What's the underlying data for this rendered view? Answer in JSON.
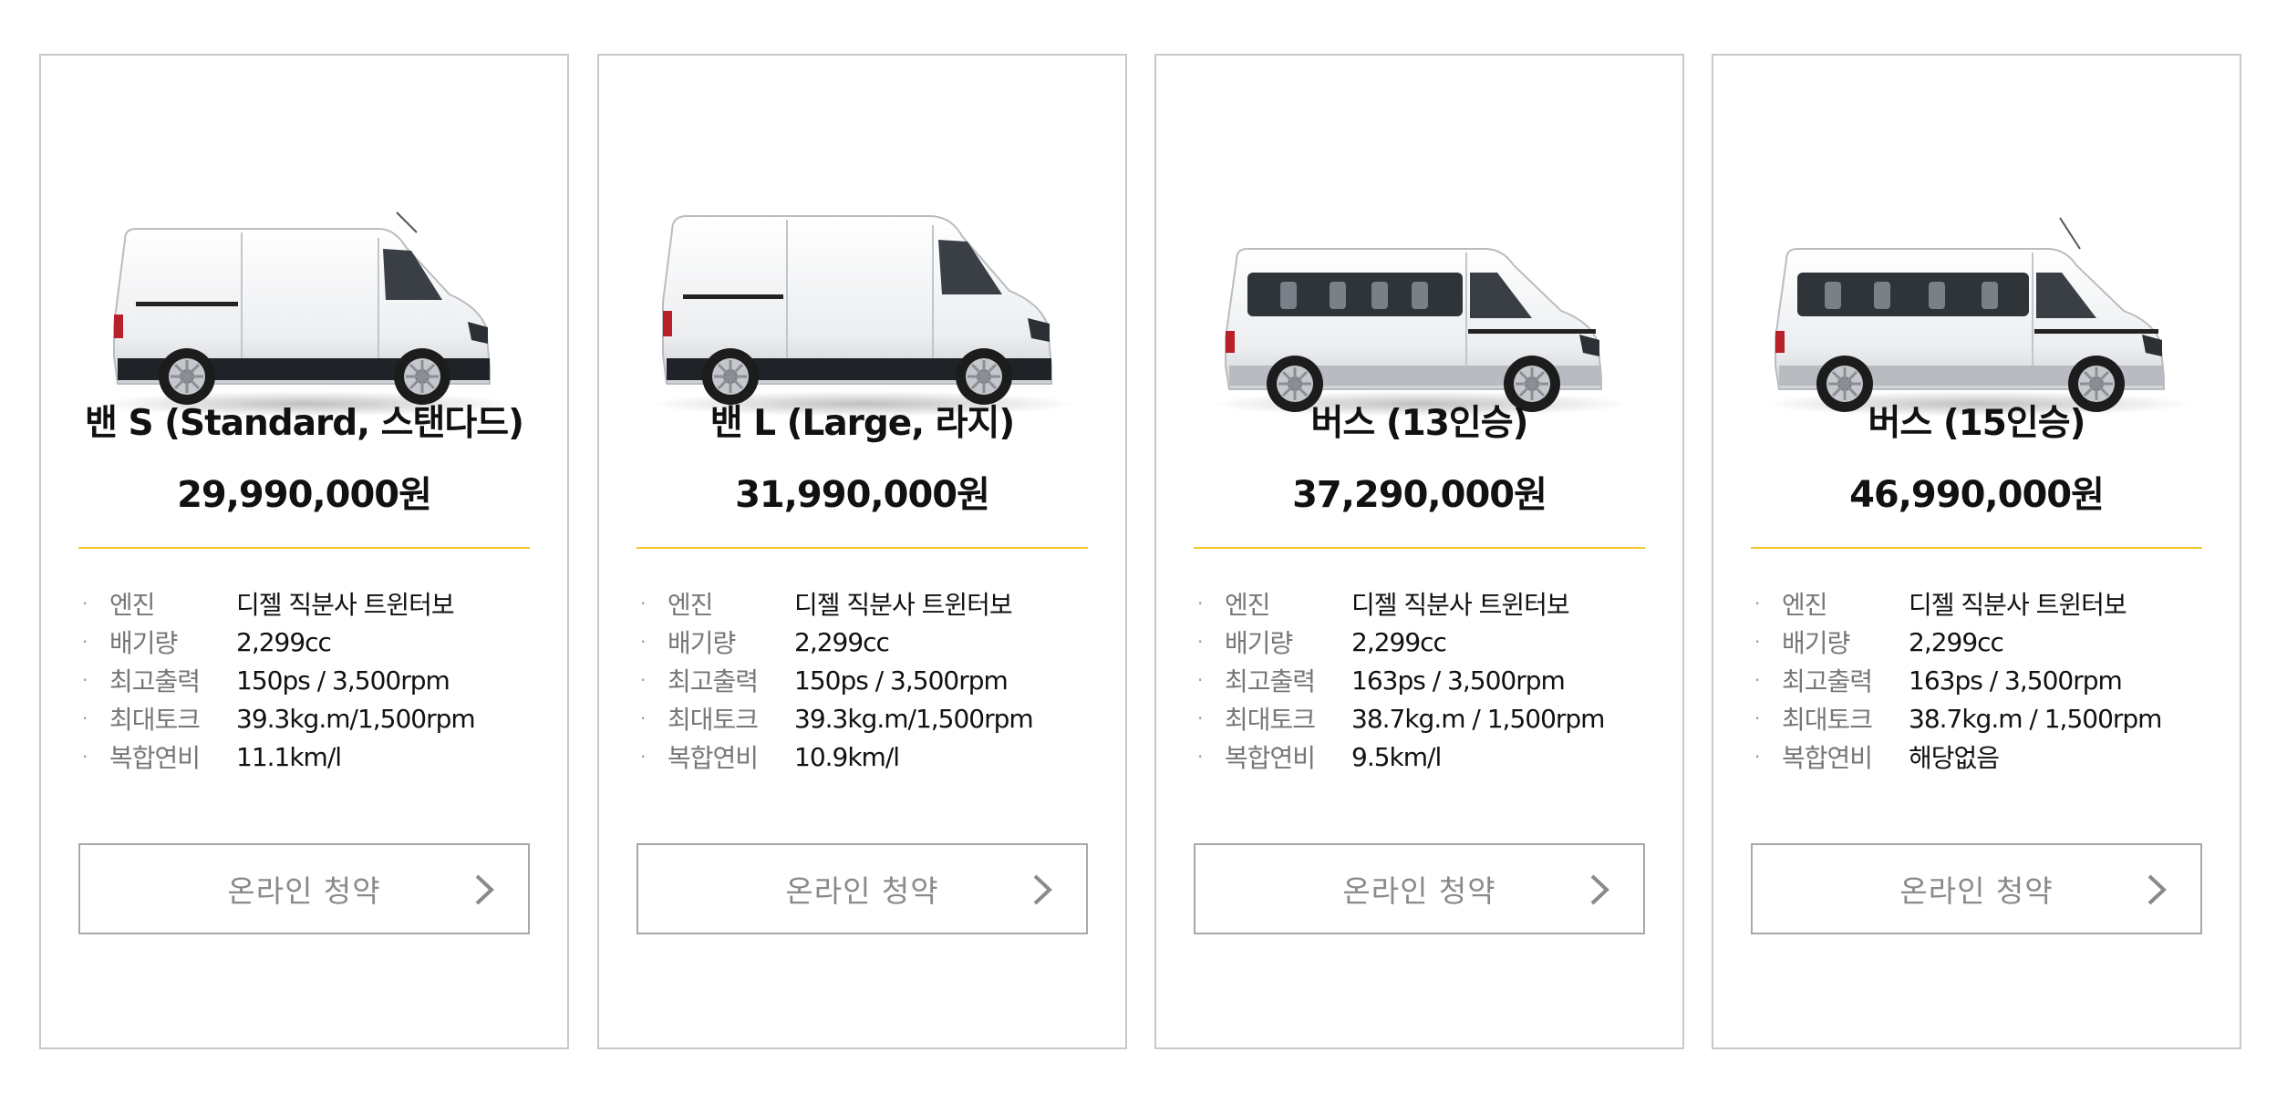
{
  "cards": [
    {
      "name": "밴 S (Standard, 스탠다드)",
      "price": "29,990,000원",
      "vehicle_icon": "cargo-van-short-image",
      "specs": [
        {
          "label": "엔진",
          "value": "디젤 직분사 트윈터보"
        },
        {
          "label": "배기량",
          "value": "2,299cc"
        },
        {
          "label": "최고출력",
          "value": "150ps / 3,500rpm"
        },
        {
          "label": "최대토크",
          "value": "39.3kg.m/1,500rpm"
        },
        {
          "label": "복합연비",
          "value": "11.1km/l"
        }
      ],
      "button_label": "온라인 청약"
    },
    {
      "name": "밴 L (Large, 라지)",
      "price": "31,990,000원",
      "vehicle_icon": "cargo-van-long-image",
      "specs": [
        {
          "label": "엔진",
          "value": "디젤 직분사 트윈터보"
        },
        {
          "label": "배기량",
          "value": "2,299cc"
        },
        {
          "label": "최고출력",
          "value": "150ps / 3,500rpm"
        },
        {
          "label": "최대토크",
          "value": "39.3kg.m/1,500rpm"
        },
        {
          "label": "복합연비",
          "value": "10.9km/l"
        }
      ],
      "button_label": "온라인 청약"
    },
    {
      "name": "버스 (13인승)",
      "price": "37,290,000원",
      "vehicle_icon": "minibus-13-seat-image",
      "specs": [
        {
          "label": "엔진",
          "value": "디젤 직분사 트윈터보"
        },
        {
          "label": "배기량",
          "value": "2,299cc"
        },
        {
          "label": "최고출력",
          "value": "163ps / 3,500rpm"
        },
        {
          "label": "최대토크",
          "value": "38.7kg.m / 1,500rpm"
        },
        {
          "label": "복합연비",
          "value": "9.5km/l"
        }
      ],
      "button_label": "온라인 청약"
    },
    {
      "name": "버스 (15인승)",
      "price": "46,990,000원",
      "vehicle_icon": "minibus-15-seat-image",
      "specs": [
        {
          "label": "엔진",
          "value": "디젤 직분사 트윈터보"
        },
        {
          "label": "배기량",
          "value": "2,299cc"
        },
        {
          "label": "최고출력",
          "value": "163ps / 3,500rpm"
        },
        {
          "label": "최대토크",
          "value": "38.7kg.m / 1,500rpm"
        },
        {
          "label": "복합연비",
          "value": "해당없음"
        }
      ],
      "button_label": "온라인 청약"
    }
  ],
  "colors": {
    "divider": "#f2c62e",
    "card_border": "#c8c8c8",
    "button_border": "#a8a8a8",
    "button_text": "#8a8a8a",
    "spec_label": "#777777"
  }
}
